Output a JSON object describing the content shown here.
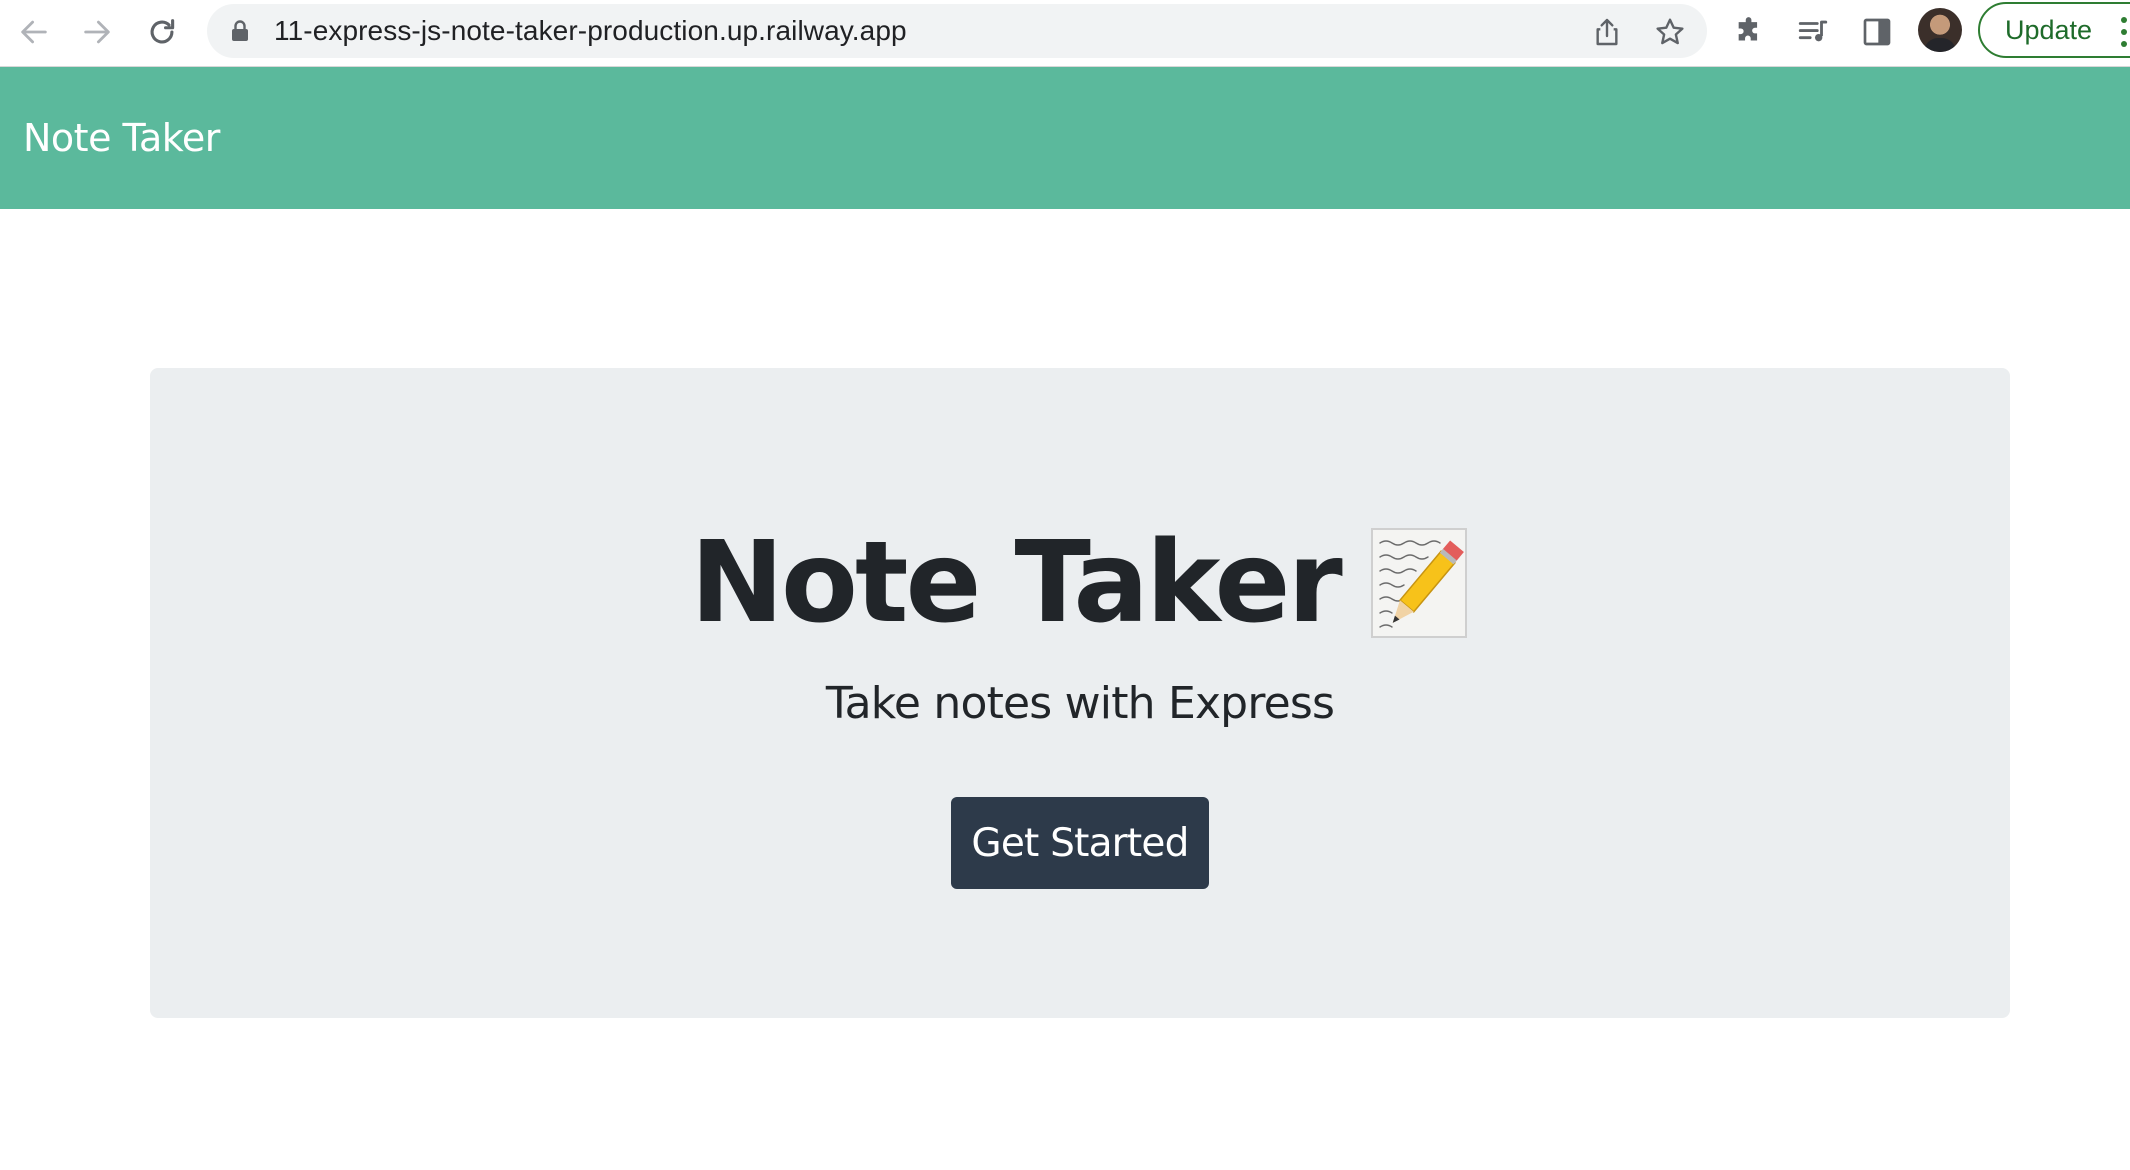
{
  "browser": {
    "url": "11-express-js-note-taker-production.up.railway.app",
    "update_label": "Update",
    "icons": {
      "back": "back-arrow-icon",
      "forward": "forward-arrow-icon",
      "reload": "reload-icon",
      "lock": "lock-icon",
      "share": "share-icon",
      "bookmark": "star-icon",
      "extensions": "puzzle-icon",
      "reading_list": "reading-list-icon",
      "side_panel": "side-panel-icon",
      "profile": "avatar",
      "menu": "kebab-menu-icon"
    }
  },
  "navbar": {
    "brand": "Note Taker",
    "background": "#5bb99c"
  },
  "hero": {
    "title": "Note Taker",
    "emoji": "memo-pencil-icon",
    "subtitle": "Take notes with Express",
    "cta_label": "Get Started",
    "cta_color": "#2d3a4a",
    "panel_color": "#ebeef0"
  }
}
